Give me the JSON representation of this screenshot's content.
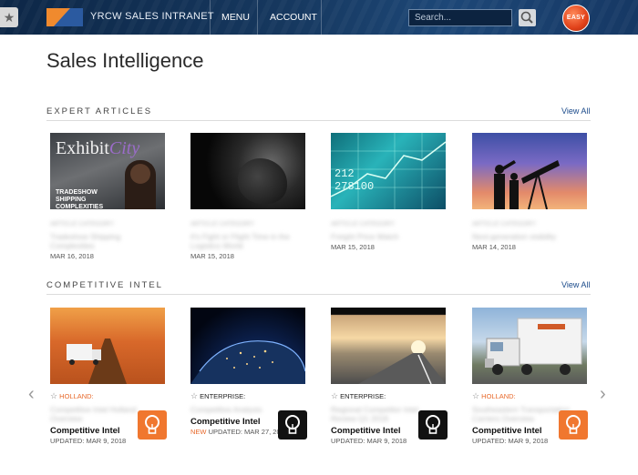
{
  "header": {
    "brand": "YRCW SALES INTRANET",
    "nav": [
      "MENU",
      "ACCOUNT"
    ],
    "search_placeholder": "Search...",
    "easy_label": "EASY"
  },
  "page_title": "Sales Intelligence",
  "expert_articles": {
    "title": "EXPERT ARTICLES",
    "view_all": "View All",
    "items": [
      {
        "dates": "MAR 16, 2018",
        "thumb_text_main": "Exhibit",
        "thumb_text_accent": "City",
        "thumb_text_caption": "TRADESHOW SHIPPING COMPLEXITIES"
      },
      {
        "dates": "MAR 15, 2018"
      },
      {
        "dates": "MAR 15, 2018",
        "ticker": [
          "212",
          "278100"
        ]
      },
      {
        "dates": "MAR 14, 2018"
      }
    ]
  },
  "competitive_intel": {
    "title": "COMPETITIVE INTEL",
    "view_all": "View All",
    "items": [
      {
        "tag": "HOLLAND:",
        "tag_color": "#e8692b",
        "title": "Competitive Intel",
        "new": "",
        "updated": "UPDATED: MAR 9, 2018",
        "icon_bg": "#f0772f"
      },
      {
        "tag": "ENTERPRISE:",
        "tag_color": "#222222",
        "title": "Competitive Intel",
        "new": "NEW",
        "updated": " UPDATED: MAR 27, 2018",
        "icon_bg": "#111111"
      },
      {
        "tag": "ENTERPRISE:",
        "tag_color": "#222222",
        "title": "Competitive Intel",
        "new": "",
        "updated": "UPDATED: MAR 9, 2018",
        "icon_bg": "#111111"
      },
      {
        "tag": "HOLLAND:",
        "tag_color": "#e8692b",
        "title": "Competitive Intel",
        "new": "",
        "updated": "UPDATED: MAR 9, 2018",
        "icon_bg": "#f0772f"
      }
    ]
  },
  "colors": {
    "accent": "#e8692b",
    "link": "#1a4a8a",
    "header": "#16385f"
  }
}
